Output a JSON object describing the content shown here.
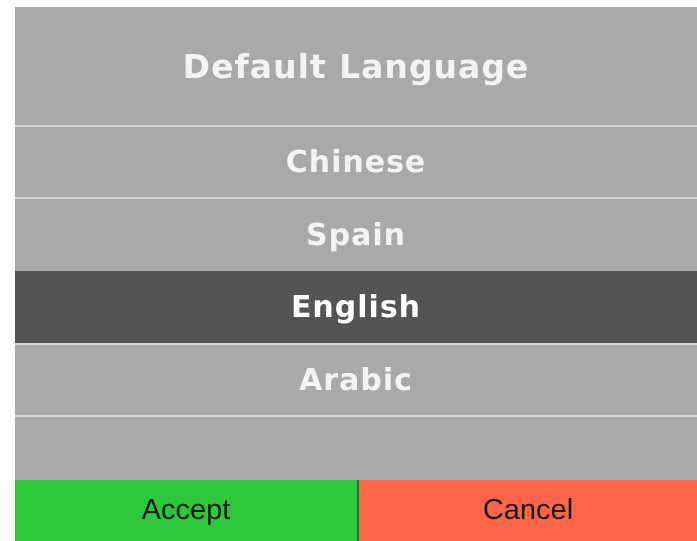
{
  "dialog": {
    "title": "Default Language",
    "languages": [
      {
        "label": "Chinese",
        "selected": false
      },
      {
        "label": "Spain",
        "selected": false
      },
      {
        "label": "English",
        "selected": true
      },
      {
        "label": "Arabic",
        "selected": false
      }
    ],
    "selected_language": "English",
    "accept_label": "Accept",
    "cancel_label": "Cancel"
  },
  "colors": {
    "panel_bg": "#a9a9a9",
    "selected_bg": "#545454",
    "accept_bg": "#2ec63a",
    "cancel_bg": "#ff6548",
    "text_light": "#f3f3f3"
  }
}
